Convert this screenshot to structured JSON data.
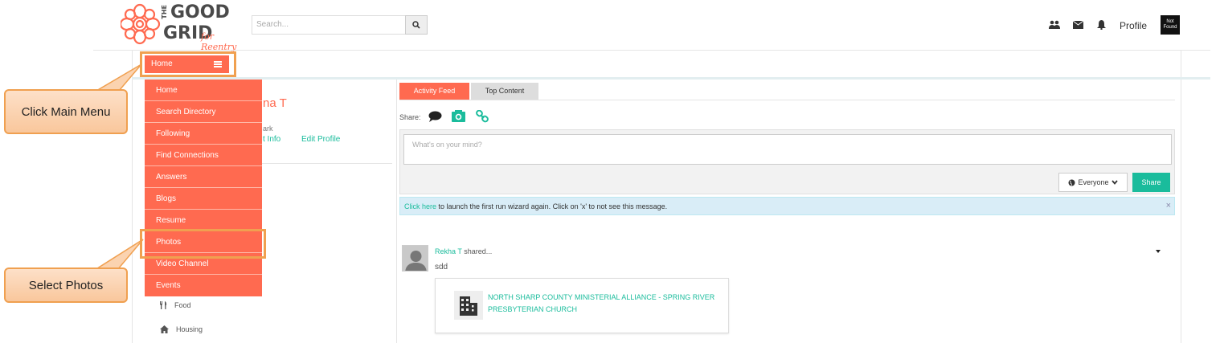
{
  "header": {
    "logo": {
      "line1": "THE",
      "line2": "GOOD",
      "line3": "GRID",
      "tagline": "for Reentry"
    },
    "search_placeholder": "Search...",
    "profile_label": "Profile",
    "avatar_text": "Not Found"
  },
  "home_button_label": "Home",
  "menu": {
    "items": [
      "Home",
      "Search Directory",
      "Following",
      "Find Connections",
      "Answers",
      "Blogs",
      "Resume",
      "Photos",
      "Video Channel",
      "Events"
    ]
  },
  "callouts": {
    "main_menu": "Click Main Menu",
    "photos": "Select Photos"
  },
  "left_column": {
    "name_fragment": "na T",
    "small_fragment": "ark",
    "contact_fragment": "t Info",
    "edit_profile": "Edit Profile",
    "categories": [
      "Food",
      "Housing"
    ]
  },
  "feed": {
    "tabs": [
      "Activity Feed",
      "Top Content"
    ],
    "share_label": "Share:",
    "compose_placeholder": "What's on your mind?",
    "visibility": "Everyone",
    "share_button": "Share",
    "notice_link": "Click here",
    "notice_text": " to launch the first run wizard again. Click on 'x' to not see this message.",
    "notice_close": "×",
    "post": {
      "author": "Rekha T",
      "action": " shared...",
      "text": "sdd",
      "card_title": "NORTH SHARP COUNTY MINISTERIAL ALLIANCE - SPRING RIVER PRESBYTERIAN CHURCH"
    }
  },
  "colors": {
    "brand": "#ff6a50",
    "accent": "#1abc9c",
    "callout_border": "#f0a050"
  }
}
